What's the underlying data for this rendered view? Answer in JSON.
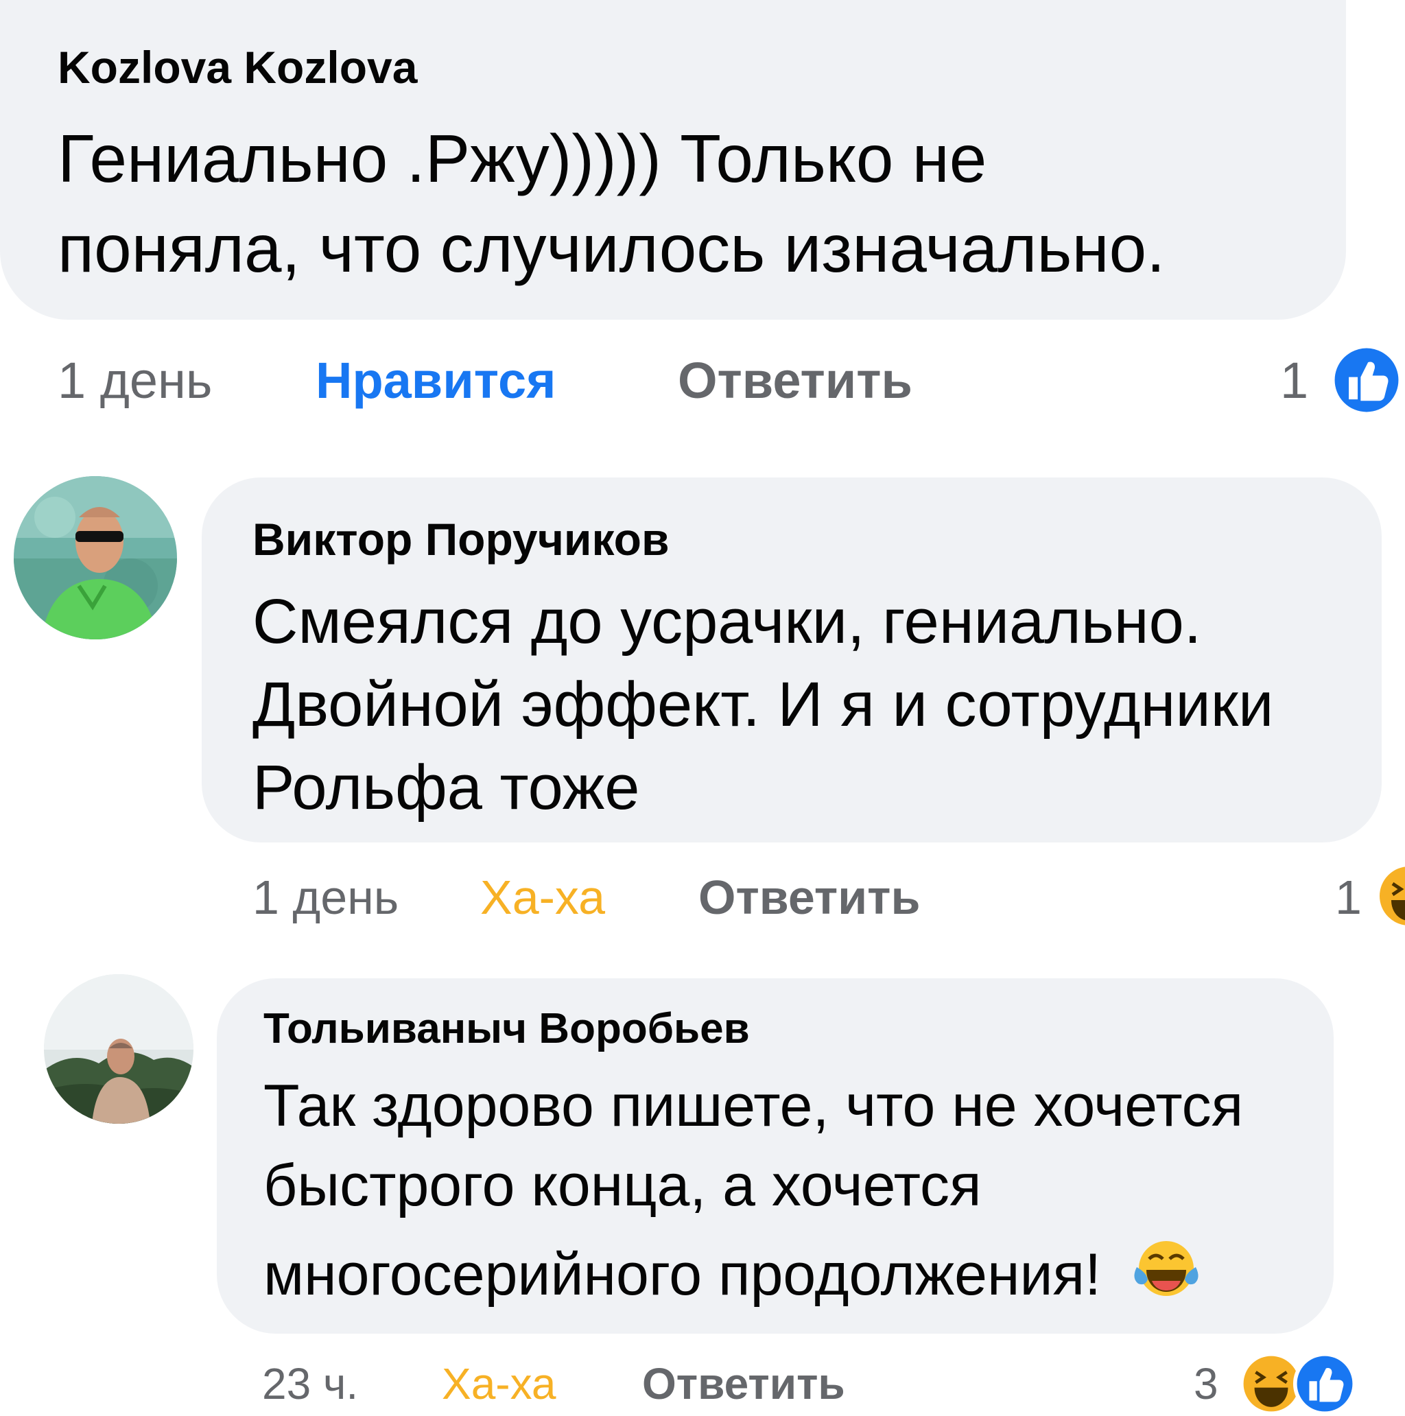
{
  "comments": [
    {
      "author": "Kozlova Kozlova",
      "lines": [
        "Гениально .Ржу))))) Только не",
        "поняла, что случилось изначально."
      ],
      "time": "1 день",
      "reaction_label": "Нравится",
      "reply_label": "Ответить",
      "reaction_count": "1",
      "reaction_icons": [
        "like-icon"
      ]
    },
    {
      "author": "Виктор Поручиков",
      "lines": [
        "Смеялся до усрачки, гениально.",
        "Двойной эффект. И я и сотрудники",
        "Рольфа тоже"
      ],
      "time": "1 день",
      "reaction_label": "Ха-ха",
      "reply_label": "Ответить",
      "reaction_count": "1",
      "reaction_icons": [
        "haha-icon"
      ]
    },
    {
      "author": "Тольиваныч Воробьев",
      "lines": [
        "Так здорово пишете, что не хочется",
        "быстрого конца, а хочется",
        "многосерийного продолжения!"
      ],
      "inline_emoji": "tears-of-joy-emoji",
      "time": "23 ч.",
      "reaction_label": "Ха-ха",
      "reply_label": "Ответить",
      "reaction_count": "3",
      "reaction_icons": [
        "haha-icon",
        "like-icon"
      ]
    }
  ],
  "colors": {
    "bubble": "#f0f2f5",
    "like_blue": "#1877f2",
    "haha_yellow": "#f7b125",
    "meta_gray": "#65676b"
  }
}
